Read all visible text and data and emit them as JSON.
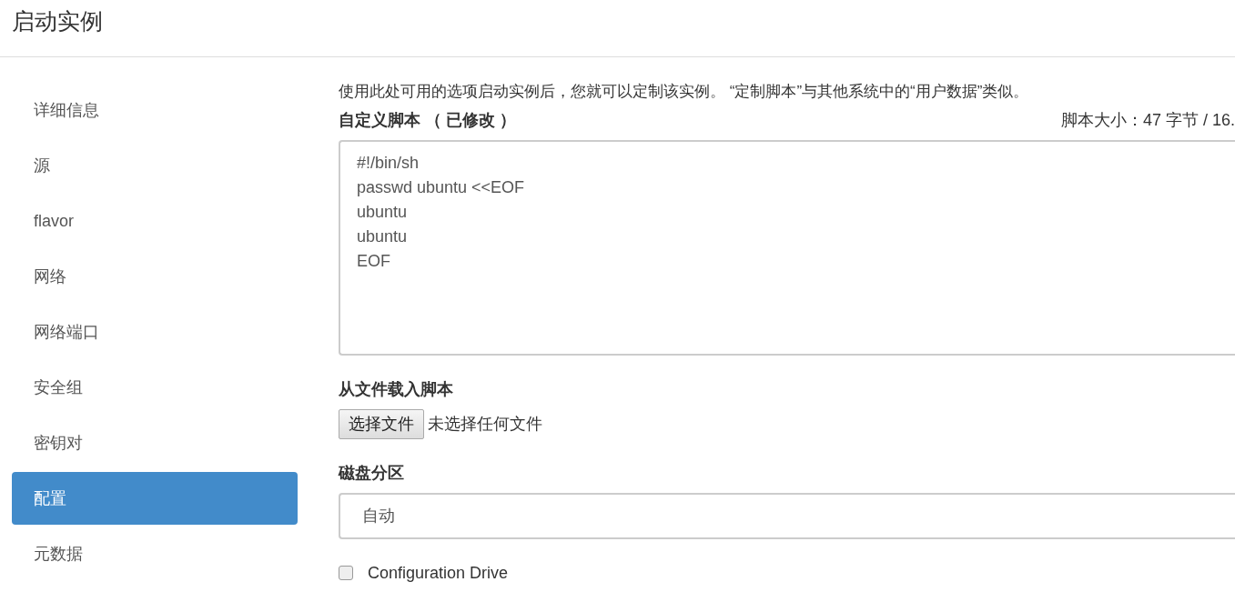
{
  "window": {
    "title": "启动实例"
  },
  "sidebar": {
    "items": [
      {
        "label": "详细信息",
        "selected": false
      },
      {
        "label": "源",
        "selected": false
      },
      {
        "label": "flavor",
        "selected": false
      },
      {
        "label": "网络",
        "selected": false
      },
      {
        "label": "网络端口",
        "selected": false
      },
      {
        "label": "安全组",
        "selected": false
      },
      {
        "label": "密钥对",
        "selected": false
      },
      {
        "label": "配置",
        "selected": true
      },
      {
        "label": "元数据",
        "selected": false
      }
    ]
  },
  "description": "使用此处可用的选项启动实例后，您就可以定制该实例。 “定制脚本”与其他系统中的“用户数据”类似。",
  "custom_script": {
    "label": "自定义脚本 （ 已修改 ）",
    "size": "脚本大小：47 字节 / 16.",
    "value": "#!/bin/sh\npasswd ubuntu <<EOF\nubuntu\nubuntu\nEOF"
  },
  "load_script": {
    "label": "从文件载入脚本",
    "button": "选择文件",
    "status": "未选择任何文件"
  },
  "disk_partition": {
    "label": "磁盘分区",
    "value": "自动"
  },
  "config_drive": {
    "label": "Configuration Drive",
    "checked": false
  }
}
